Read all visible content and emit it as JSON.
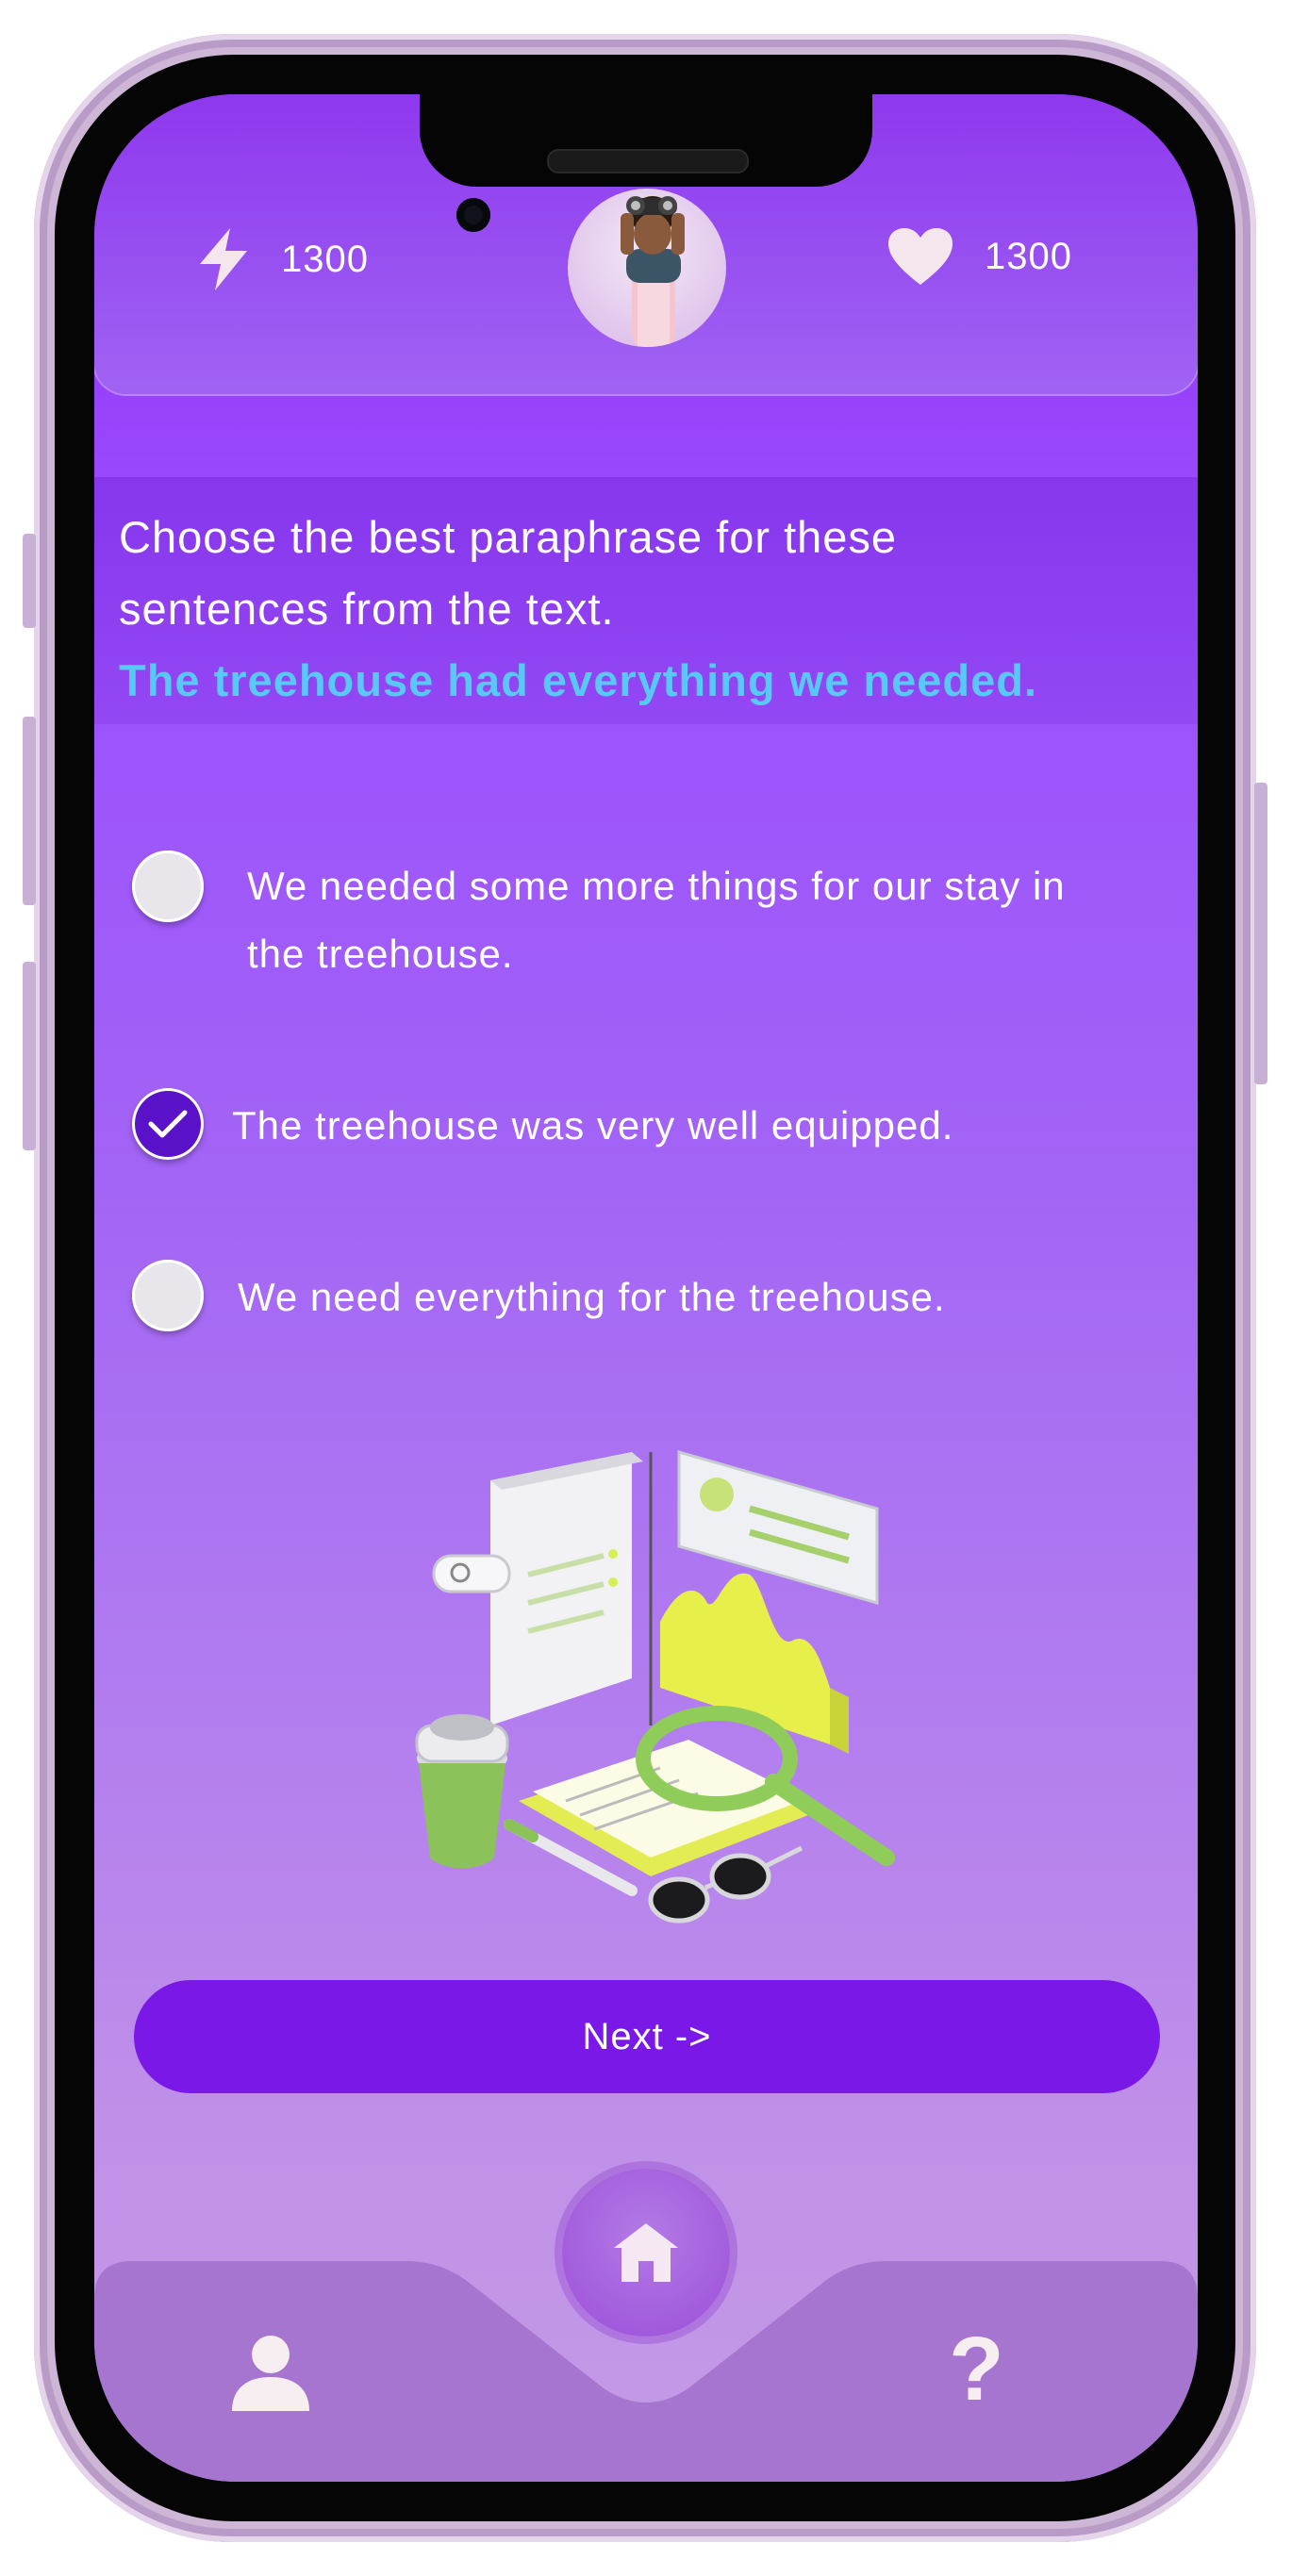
{
  "header": {
    "energy_icon": "lightning-icon",
    "energy_value": "1300",
    "lives_icon": "heart-icon",
    "lives_value": "1300",
    "avatar_description_icon": "avatar-child-binoculars"
  },
  "question": {
    "prompt_line1": "Choose the best paraphrase for these",
    "prompt_line2": "sentences from the text.",
    "highlight": "The treehouse had everything we needed."
  },
  "options": [
    {
      "line1": "We needed some more things for our stay in",
      "line2": "the treehouse.",
      "selected": false
    },
    {
      "line1": "The treehouse was very well equipped.",
      "line2": "",
      "selected": true
    },
    {
      "line1": "We need everything for the treehouse.",
      "line2": "",
      "selected": false
    }
  ],
  "next_button": {
    "label": "Next ->"
  },
  "nav": {
    "profile_icon": "user-icon",
    "home_icon": "home-icon",
    "help_label": "?"
  },
  "colors": {
    "accent": "#7a18e8",
    "highlight_text": "#58c9f7",
    "selected_radio": "#5a12c9"
  }
}
